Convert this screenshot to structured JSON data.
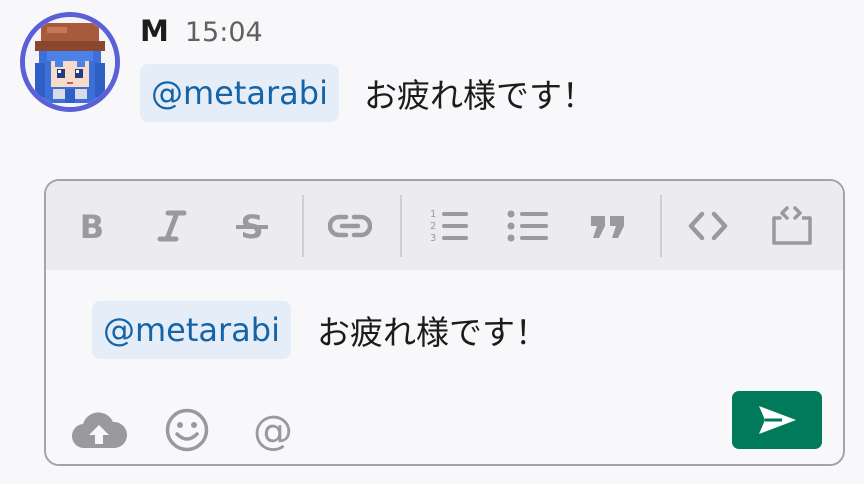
{
  "message": {
    "sender": "M",
    "time": "15:04",
    "mention": "@metarabi",
    "text": "お疲れ様です！",
    "avatar": "pixel-character-avatar"
  },
  "composer": {
    "toolbar": [
      {
        "name": "bold",
        "icon": "bold-icon"
      },
      {
        "name": "italic",
        "icon": "italic-icon"
      },
      {
        "name": "strikethrough",
        "icon": "strikethrough-icon"
      },
      {
        "name": "link",
        "icon": "link-icon"
      },
      {
        "name": "ordered-list",
        "icon": "ordered-list-icon"
      },
      {
        "name": "bulleted-list",
        "icon": "bulleted-list-icon"
      },
      {
        "name": "blockquote",
        "icon": "quote-icon"
      },
      {
        "name": "code",
        "icon": "code-icon"
      },
      {
        "name": "code-block",
        "icon": "code-block-icon"
      }
    ],
    "draft": {
      "mention": "@metarabi",
      "text": "お疲れ様です！"
    },
    "actions": [
      {
        "name": "upload",
        "icon": "cloud-upload-icon"
      },
      {
        "name": "emoji",
        "icon": "emoji-icon"
      },
      {
        "name": "mention",
        "icon": "at-sign-icon"
      }
    ],
    "send": {
      "icon": "send-icon"
    }
  },
  "colors": {
    "mention_bg": "#e5eef8",
    "mention_text": "#1664a6",
    "send_button": "#007a5a",
    "avatar_ring": "#5b5fd8",
    "icon_gray": "#9a9a9c"
  }
}
